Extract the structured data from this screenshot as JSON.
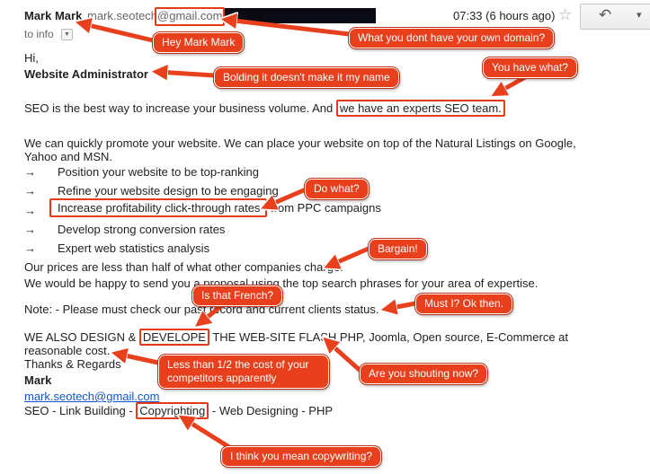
{
  "email": {
    "sender_name": "Mark Mark",
    "sender_email": "mark.seotech@gmail.com",
    "time": "07:33 (6 hours ago)",
    "to_label": "to info",
    "greeting": "Hi,",
    "recipient_title": "Website Administrator",
    "intro_before": "SEO is the best way to increase your business volume. And ",
    "intro_highlight": "we have an experts SEO team.",
    "promote_line1": "We can quickly promote your website. We can place your website on top of the Natural Listings on Google,",
    "promote_line2": "Yahoo and MSN.",
    "bullet_glyph": "→",
    "bullets": [
      "Position your website to be top-ranking",
      "Refine your website design to be engaging",
      "Increase profitability click-through rates",
      "Develop strong conversion rates",
      "Expert web statistics analysis"
    ],
    "bullet3_suffix": " from PPC campaigns",
    "prices": "Our prices are less than half of what other companies charge.",
    "proposal": "We would be happy to send you a proposal using the top search phrases for your area of expertise.",
    "note": "Note: - Please must check our past record and current clients status.",
    "design_before": "WE ALSO  DESIGN & ",
    "design_highlight": "DEVELOPE",
    "design_after": " THE WEB-SITE FLASH PHP, Joomla, Open source, E-Commerce at",
    "design_line2": "reasonable cost.",
    "thanks": "Thanks & Regards",
    "signature_name": "Mark",
    "signature_email": "mark.seotech@gmail.com",
    "services_before": "SEO - Link Building - ",
    "services_highlight": "Copyrighting",
    "services_after": " - Web Designing - PHP"
  },
  "annotations": {
    "hey_mark": "Hey Mark Mark",
    "own_domain": "What you dont have your own domain?",
    "bolding": "Bolding it doesn't make it my name",
    "you_have_what": "You have what?",
    "do_what": "Do what?",
    "bargain": "Bargain!",
    "must_i": "Must I? Ok then.",
    "french": "Is that French?",
    "shouting": "Are you shouting now?",
    "less_half": "Less than 1/2 the cost of your competitors apparently",
    "copywriting": "I think you mean copywriting?"
  },
  "icons": {
    "star": "☆",
    "reply": "↶",
    "more": "▾",
    "dropdown": "▼"
  },
  "colors": {
    "callout": "#e8401c",
    "highlight_box": "#e23b1c",
    "link": "#1155cc"
  }
}
